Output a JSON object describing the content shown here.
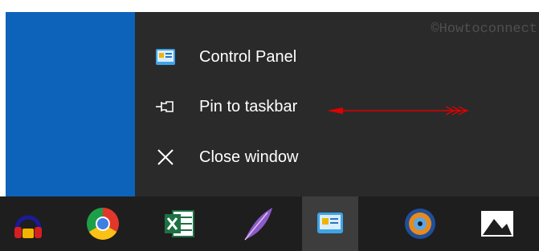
{
  "watermark": "©Howtoconnect",
  "jumplist": {
    "items": [
      {
        "label": "Control Panel",
        "icon": "control-panel-icon"
      },
      {
        "label": "Pin to taskbar",
        "icon": "pin-icon"
      },
      {
        "label": "Close window",
        "icon": "close-icon"
      }
    ]
  },
  "annotation": {
    "arrow_color": "#e00000"
  },
  "taskbar": {
    "apps": [
      {
        "name": "headphones-app-icon"
      },
      {
        "name": "chrome-icon"
      },
      {
        "name": "excel-icon"
      },
      {
        "name": "feather-app-icon"
      },
      {
        "name": "control-panel-icon",
        "active": true
      },
      {
        "name": "media-player-icon"
      },
      {
        "name": "photos-icon"
      }
    ]
  },
  "colors": {
    "desktop": "#0d63ba",
    "jumplist_bg": "#2a2a2a",
    "taskbar_bg": "#1e1e1e",
    "active_button": "#3d3d3d"
  }
}
